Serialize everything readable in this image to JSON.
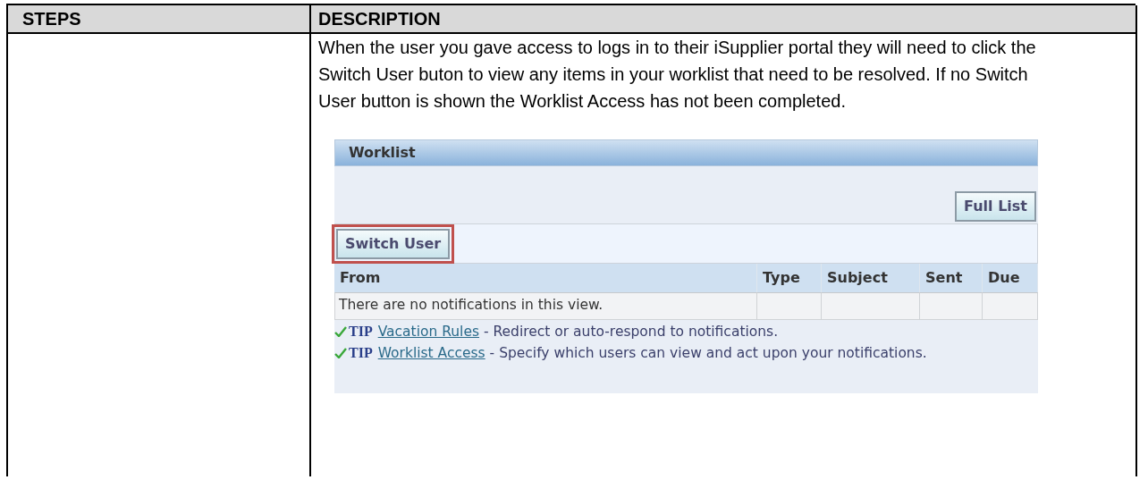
{
  "document_table": {
    "columns": [
      "STEPS",
      "DESCRIPTION"
    ],
    "description": "When the user you gave access to logs in to their iSupplier portal they will need to click the Switch User buton to view any items in your worklist that need to be resolved. If no Switch User button is shown the Worklist Access has not been completed.",
    "worklist": {
      "title": "Worklist",
      "full_list_button": "Full List",
      "switch_user_button": {
        "label": "Switch User",
        "highlighted": true
      },
      "columns": [
        "From",
        "Type",
        "Subject",
        "Sent",
        "Due"
      ],
      "empty_message": "There are no notifications in this view.",
      "tips": [
        {
          "label": "TIP",
          "link": "Vacation Rules",
          "text": "- Redirect or auto-respond to notifications."
        },
        {
          "label": "TIP",
          "link": "Worklist Access",
          "text": "- Specify which users can view and act upon your notifications."
        }
      ]
    }
  }
}
